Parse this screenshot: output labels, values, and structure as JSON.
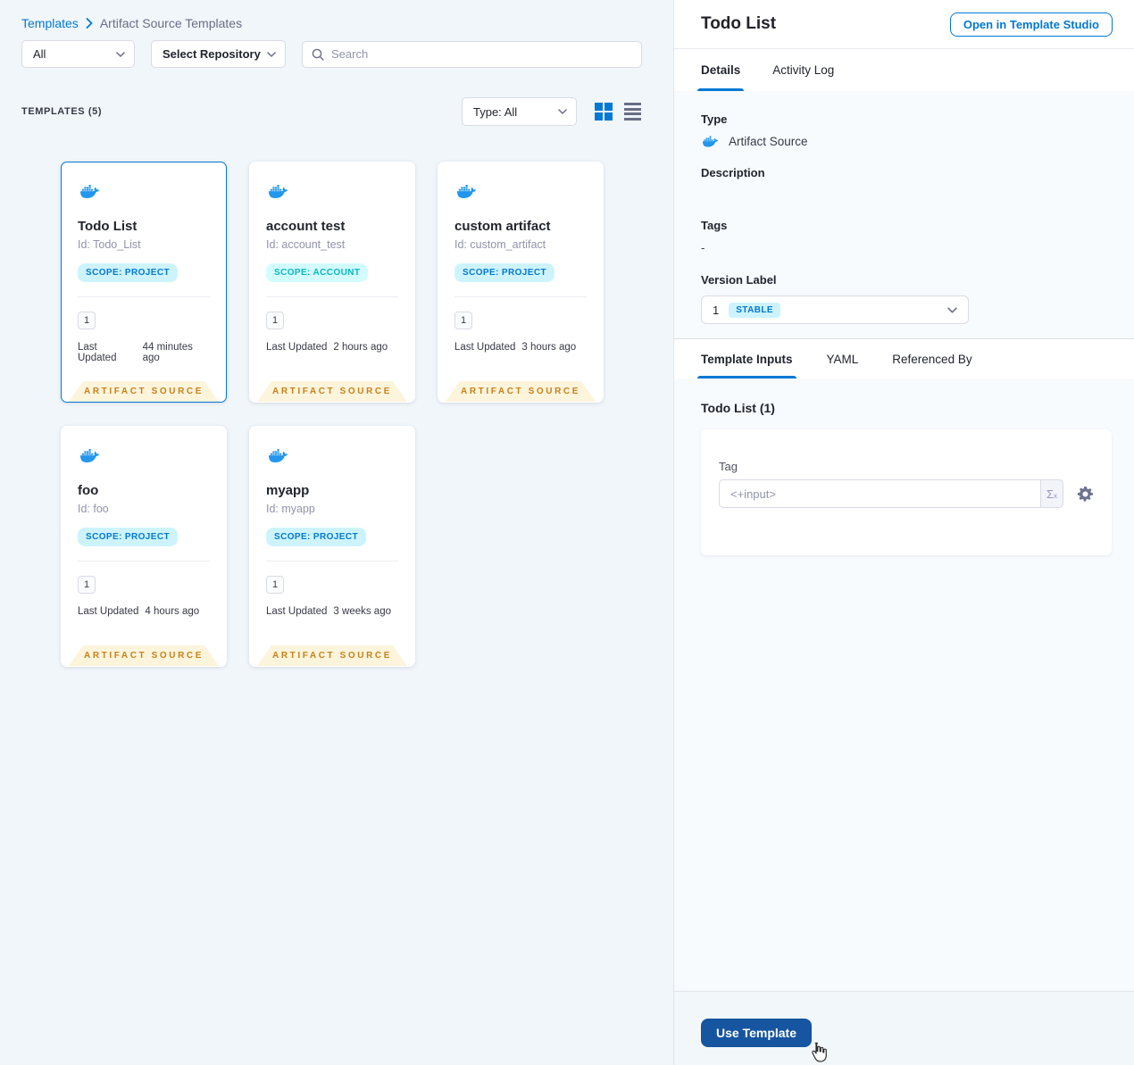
{
  "breadcrumb": {
    "root": "Templates",
    "current": "Artifact Source Templates"
  },
  "filters": {
    "scope": "All",
    "repository": "Select Repository",
    "search_placeholder": "Search",
    "type": "Type: All"
  },
  "list_header": {
    "count_label": "TEMPLATES (5)"
  },
  "cards": [
    {
      "title": "Todo List",
      "id": "Id: Todo_List",
      "scope": "SCOPE: PROJECT",
      "version": "1",
      "updated_label": "Last Updated",
      "updated_value": "44 minutes ago",
      "type_badge": "ARTIFACT SOURCE"
    },
    {
      "title": "account test",
      "id": "Id: account_test",
      "scope": "SCOPE: ACCOUNT",
      "version": "1",
      "updated_label": "Last Updated",
      "updated_value": "2 hours ago",
      "type_badge": "ARTIFACT SOURCE"
    },
    {
      "title": "custom artifact",
      "id": "Id: custom_artifact",
      "scope": "SCOPE: PROJECT",
      "version": "1",
      "updated_label": "Last Updated",
      "updated_value": "3 hours ago",
      "type_badge": "ARTIFACT SOURCE"
    },
    {
      "title": "foo",
      "id": "Id: foo",
      "scope": "SCOPE: PROJECT",
      "version": "1",
      "updated_label": "Last Updated",
      "updated_value": "4 hours ago",
      "type_badge": "ARTIFACT SOURCE"
    },
    {
      "title": "myapp",
      "id": "Id: myapp",
      "scope": "SCOPE: PROJECT",
      "version": "1",
      "updated_label": "Last Updated",
      "updated_value": "3 weeks ago",
      "type_badge": "ARTIFACT SOURCE"
    }
  ],
  "panel": {
    "title": "Todo List",
    "open_button": "Open in Template Studio",
    "tabs": {
      "details": "Details",
      "activity": "Activity Log"
    },
    "details": {
      "type_label": "Type",
      "type_value": "Artifact Source",
      "description_label": "Description",
      "tags_label": "Tags",
      "tags_value": "-",
      "version_label": "Version Label",
      "version_value": "1",
      "version_badge": "STABLE"
    },
    "inputs_tabs": {
      "template_inputs": "Template Inputs",
      "yaml": "YAML",
      "referenced_by": "Referenced By"
    },
    "inputs": {
      "title": "Todo List (1)",
      "tag_label": "Tag",
      "tag_placeholder": "<+input>",
      "expression_symbol": "Σ",
      "expression_sub": "x"
    },
    "footer": {
      "use_template": "Use Template"
    }
  },
  "colors": {
    "primary_blue": "#0278d5",
    "docker_blue": "#2396ed",
    "type_badge_bg": "#fdf4dc",
    "type_badge_text": "#c8811a",
    "scope_project_bg": "#cdf4fe",
    "scope_project_text": "#0278d5",
    "scope_account_bg": "#d3fcfe",
    "scope_account_text": "#06b7c4",
    "use_template_bg": "#1655a0"
  }
}
